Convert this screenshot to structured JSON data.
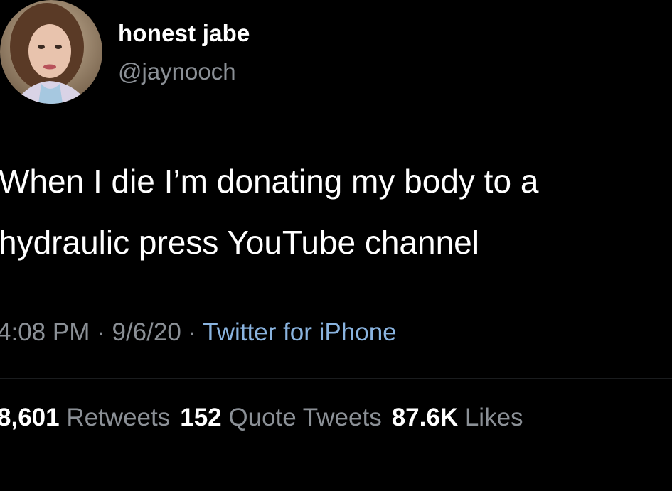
{
  "tweet": {
    "author": {
      "display_name": "honest jabe",
      "handle": "@jaynooch"
    },
    "text_lines": [
      "When I die I’m donating my body to a",
      "hydraulic press YouTube channel"
    ],
    "time": "4:08 PM",
    "date": "9/6/20",
    "separator": "·",
    "source": "Twitter for iPhone",
    "stats": {
      "retweets_count": "8,601",
      "retweets_label": "Retweets",
      "quotes_count": "152",
      "quotes_label": "Quote Tweets",
      "likes_count": "87.6K",
      "likes_label": "Likes"
    }
  },
  "colors": {
    "background": "#000000",
    "primary_text": "#ffffff",
    "secondary_text": "#8b9096",
    "link": "#8ab4e0"
  }
}
